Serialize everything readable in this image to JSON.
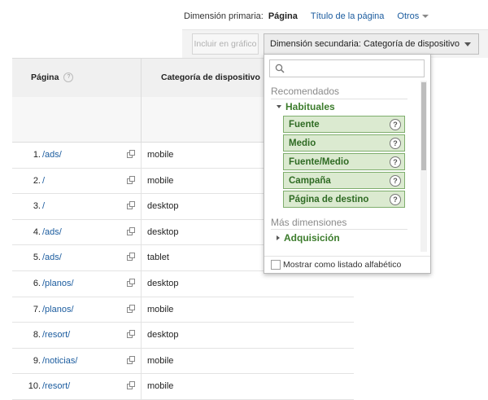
{
  "dimension_bar": {
    "primary_label": "Dimensión primaria:",
    "active": "Página",
    "link_title": "Título de la página",
    "others": "Otros"
  },
  "toolbar": {
    "plot_button": "Incluir en gráfico",
    "secondary_dimension_button": "Dimensión secundaria: Categoría de dispositivo"
  },
  "table": {
    "headers": {
      "page": "Página",
      "device_category": "Categoría de dispositivo"
    },
    "help_glyph": "?",
    "rows": [
      {
        "num": "1.",
        "page": "/ads/",
        "device": "mobile"
      },
      {
        "num": "2.",
        "page": "/",
        "device": "mobile"
      },
      {
        "num": "3.",
        "page": "/",
        "device": "desktop"
      },
      {
        "num": "4.",
        "page": "/ads/",
        "device": "desktop"
      },
      {
        "num": "5.",
        "page": "/ads/",
        "device": "tablet"
      },
      {
        "num": "6.",
        "page": "/planos/",
        "device": "desktop"
      },
      {
        "num": "7.",
        "page": "/planos/",
        "device": "mobile"
      },
      {
        "num": "8.",
        "page": "/resort/",
        "device": "desktop"
      },
      {
        "num": "9.",
        "page": "/noticias/",
        "device": "mobile"
      },
      {
        "num": "10.",
        "page": "/resort/",
        "device": "mobile"
      }
    ]
  },
  "dropdown": {
    "search_placeholder": "",
    "recommended_heading": "Recomendados",
    "group_habituales": "Habituales",
    "items": [
      "Fuente",
      "Medio",
      "Fuente/Medio",
      "Campaña",
      "Página de destino"
    ],
    "more_heading": "Más dimensiones",
    "group_adquisicion": "Adquisición",
    "alphabetical_label": "Mostrar como listado alfabético",
    "alphabetical_checked": false
  },
  "colors": {
    "link": "#1a5b9e",
    "item_bg": "#dbead0",
    "item_border": "#7fae6d",
    "item_text": "#2f6b24"
  }
}
